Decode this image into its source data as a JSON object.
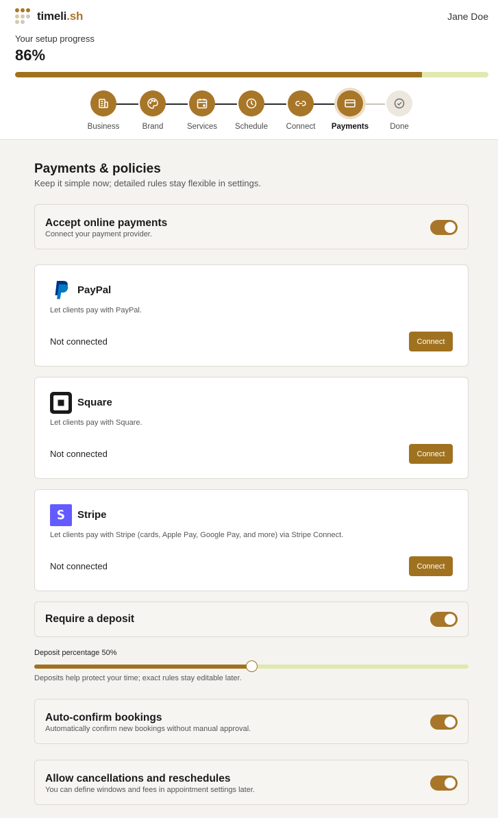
{
  "app": {
    "brand_main": "timeli",
    "brand_accent": ".sh",
    "user_name": "Jane Doe"
  },
  "progress": {
    "label": "Your setup progress",
    "value_text": "86%",
    "fraction": 0.86
  },
  "steps": [
    {
      "label": "Business",
      "icon": "building-icon",
      "state": "done"
    },
    {
      "label": "Brand",
      "icon": "palette-icon",
      "state": "done"
    },
    {
      "label": "Services",
      "icon": "calendar-plus-icon",
      "state": "done"
    },
    {
      "label": "Schedule",
      "icon": "clock-icon",
      "state": "done"
    },
    {
      "label": "Connect",
      "icon": "link-icon",
      "state": "done"
    },
    {
      "label": "Payments",
      "icon": "credit-card-icon",
      "state": "active"
    },
    {
      "label": "Done",
      "icon": "check-circle-icon",
      "state": "todo"
    }
  ],
  "section": {
    "title": "Payments & policies",
    "subtitle": "Keep it simple now; detailed rules stay flexible in settings."
  },
  "online_payments": {
    "title": "Accept online payments",
    "subtitle": "Connect your payment provider.",
    "enabled": true
  },
  "providers": [
    {
      "name": "PayPal",
      "icon": "paypal-icon",
      "description": "Let clients pay with PayPal.",
      "status": "Not connected",
      "button": "Connect"
    },
    {
      "name": "Square",
      "icon": "square-icon",
      "description": "Let clients pay with Square.",
      "status": "Not connected",
      "button": "Connect"
    },
    {
      "name": "Stripe",
      "icon": "stripe-icon",
      "description": "Let clients pay with Stripe (cards, Apple Pay, Google Pay, and more) via Stripe Connect.",
      "status": "Not connected",
      "button": "Connect"
    }
  ],
  "deposit": {
    "title": "Require a deposit",
    "enabled": true,
    "slider_label": "Deposit percentage 50%",
    "percent": 50,
    "help": "Deposits help protect your time; exact rules stay editable later."
  },
  "auto_confirm": {
    "title": "Auto-confirm bookings",
    "subtitle": "Automatically confirm new bookings without manual approval.",
    "enabled": true
  },
  "cancellations": {
    "title": "Allow cancellations and reschedules",
    "subtitle": "You can define windows and fees in appointment settings later.",
    "enabled": true
  },
  "colors": {
    "accent": "#a87628",
    "accent_dark": "#a0721f",
    "track_light": "#e1e8b0",
    "paypal_blue": "#003087",
    "stripe_purple": "#635bff"
  }
}
